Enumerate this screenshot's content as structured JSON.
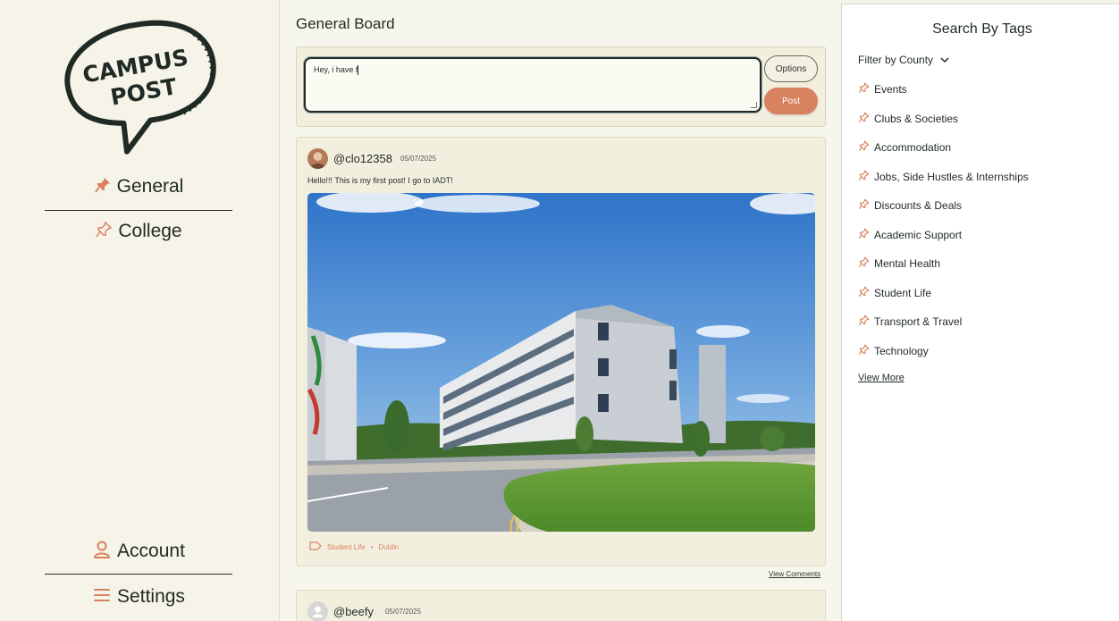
{
  "logo": {
    "line1": "CAMPUS",
    "line2": "POST"
  },
  "sidebar": {
    "nav": [
      {
        "label": "General",
        "icon": "pin-filled-icon"
      },
      {
        "label": "College",
        "icon": "pin-outline-icon"
      }
    ],
    "bottom": [
      {
        "label": "Account",
        "icon": "user-icon"
      },
      {
        "label": "Settings",
        "icon": "menu-icon"
      }
    ]
  },
  "main": {
    "title": "General Board",
    "composer": {
      "value": "Hey, i have f",
      "options_label": "Options",
      "post_label": "Post"
    },
    "posts": [
      {
        "handle": "@clo12358",
        "date": "05/07/2025",
        "body": "Hello!!! This is my first post! I go to IADT!",
        "tag": "Student Life",
        "separator": "•",
        "county": "Dublin",
        "view_comments": "View Comments"
      },
      {
        "handle": "@beefy",
        "date": "05/07/2025"
      }
    ]
  },
  "right_panel": {
    "title": "Search By Tags",
    "filter_label": "Filter by County",
    "tags": [
      "Events",
      "Clubs & Societies",
      "Accommodation",
      "Jobs, Side Hustles & Internships",
      "Discounts & Deals",
      "Academic Support",
      "Mental Health",
      "Student Life",
      "Transport & Travel",
      "Technology"
    ],
    "view_more": "View More"
  },
  "colors": {
    "accent": "#d9825f",
    "dark": "#1f2a24",
    "background": "#f6f3e8"
  }
}
